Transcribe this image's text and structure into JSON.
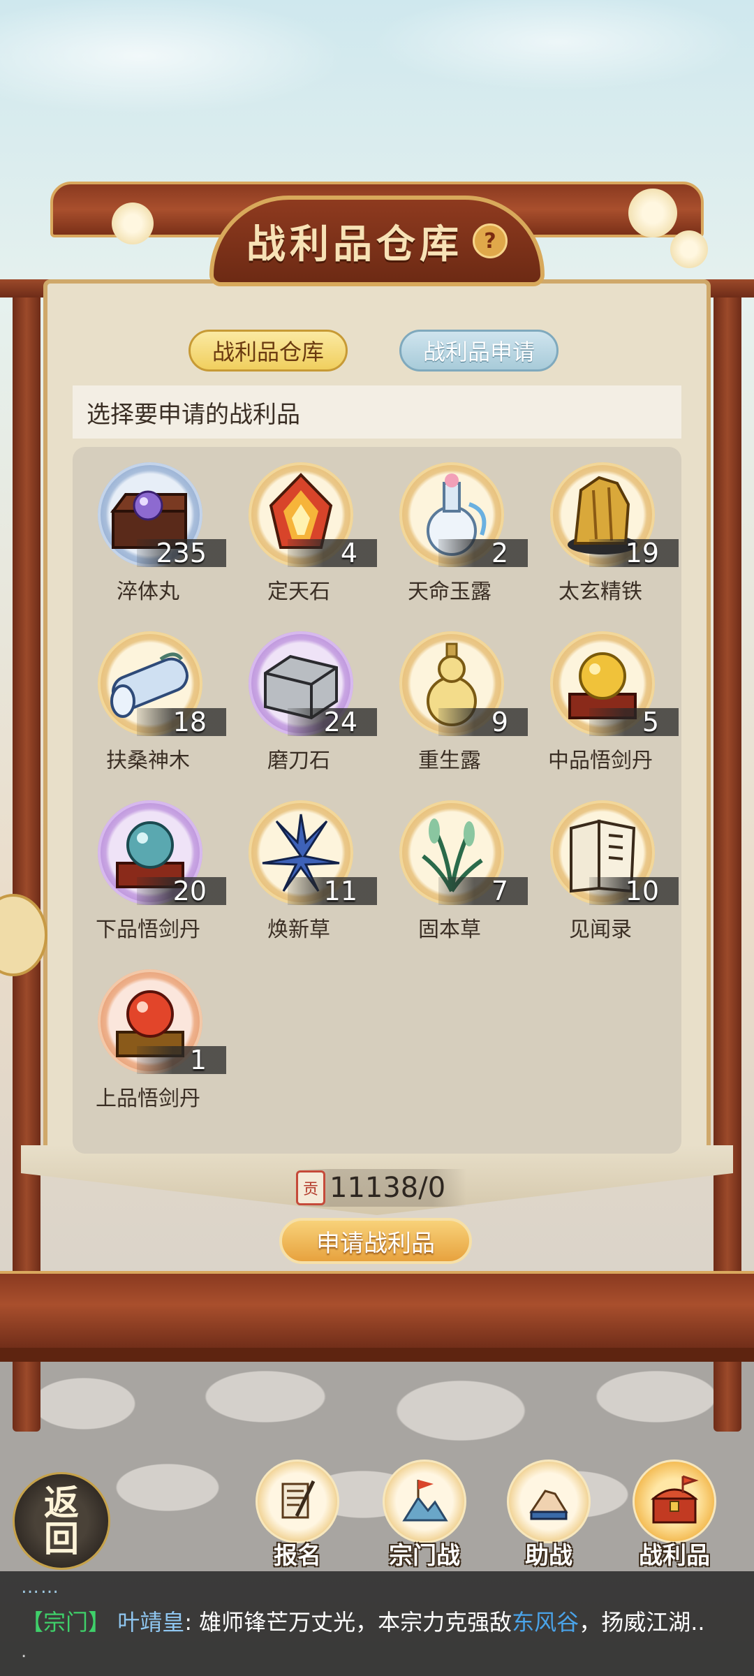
{
  "header": {
    "title": "战利品仓库",
    "help_symbol": "?"
  },
  "tabs": [
    {
      "label": "战利品仓库",
      "active": true
    },
    {
      "label": "战利品申请",
      "active": false
    }
  ],
  "instruction": "选择要申请的战利品",
  "items": [
    {
      "name": "淬体丸",
      "count": "235",
      "icon": "treasure-chest-orb-icon",
      "frame": "blue"
    },
    {
      "name": "定天石",
      "count": "4",
      "icon": "fire-crystal-icon",
      "frame": "gold"
    },
    {
      "name": "天命玉露",
      "count": "2",
      "icon": "jade-vase-icon",
      "frame": "gold"
    },
    {
      "name": "太玄精铁",
      "count": "19",
      "icon": "gold-ore-icon",
      "frame": "gold"
    },
    {
      "name": "扶桑神木",
      "count": "18",
      "icon": "divine-wood-icon",
      "frame": "gold"
    },
    {
      "name": "磨刀石",
      "count": "24",
      "icon": "whetstone-icon",
      "frame": "purple"
    },
    {
      "name": "重生露",
      "count": "9",
      "icon": "gourd-bottle-icon",
      "frame": "gold"
    },
    {
      "name": "中品悟剑丹",
      "count": "5",
      "icon": "gold-pill-icon",
      "frame": "gold"
    },
    {
      "name": "下品悟剑丹",
      "count": "20",
      "icon": "teal-pill-icon",
      "frame": "purple"
    },
    {
      "name": "焕新草",
      "count": "11",
      "icon": "blue-flower-icon",
      "frame": "gold"
    },
    {
      "name": "固本草",
      "count": "7",
      "icon": "green-herb-icon",
      "frame": "gold"
    },
    {
      "name": "见闻录",
      "count": "10",
      "icon": "book-icon",
      "frame": "gold"
    },
    {
      "name": "上品悟剑丹",
      "count": "1",
      "icon": "red-pill-icon",
      "frame": "red"
    }
  ],
  "currency": {
    "icon_char": "贡",
    "text": "11138/0"
  },
  "apply_button": "申请战利品",
  "nav": {
    "back": "返回",
    "buttons": [
      {
        "label": "报名",
        "icon": "scroll-brush-icon"
      },
      {
        "label": "宗门战",
        "icon": "flag-mountain-icon"
      },
      {
        "label": "助战",
        "icon": "handshake-icon"
      },
      {
        "label": "战利品",
        "icon": "treasure-chest-icon",
        "active": true
      }
    ]
  },
  "chat": {
    "dots": "……",
    "tag": "【宗门】",
    "name": "叶靖皇",
    "msg_part1": ": 雄师锋芒万丈光，本宗力克强敌",
    "place": "东风谷",
    "msg_part2": "，扬威江湖..",
    "trailing": "."
  },
  "colors": {
    "frame_wood": "#9c4a2a",
    "gold_trim": "#d9a85e",
    "paper": "#e8dfc9",
    "chat_tag": "#3fd06a"
  }
}
